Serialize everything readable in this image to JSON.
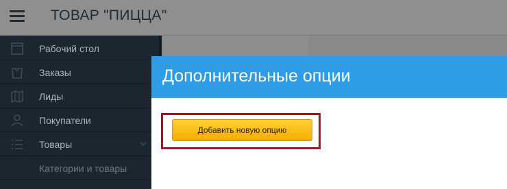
{
  "header": {
    "title": "ТОВАР \"ПИЦЦА\"",
    "menu_icon": "hamburger-menu-icon"
  },
  "sidebar": {
    "items": [
      {
        "label": "Рабочий стол",
        "icon": "calendar-icon"
      },
      {
        "label": "Заказы",
        "icon": "shopping-bag-icon"
      },
      {
        "label": "Лиды",
        "icon": "map-icon"
      },
      {
        "label": "Покупатели",
        "icon": "user-icon"
      },
      {
        "label": "Товары",
        "icon": "list-icon",
        "expanded": true
      },
      {
        "label": "Категории и товары",
        "sub": true
      }
    ]
  },
  "modal": {
    "title": "Дополнительные опции",
    "add_button_label": "Добавить новую опцию",
    "header_color": "#2f9ce8",
    "button_color": "#f7b500",
    "highlight_color": "#a31717"
  }
}
